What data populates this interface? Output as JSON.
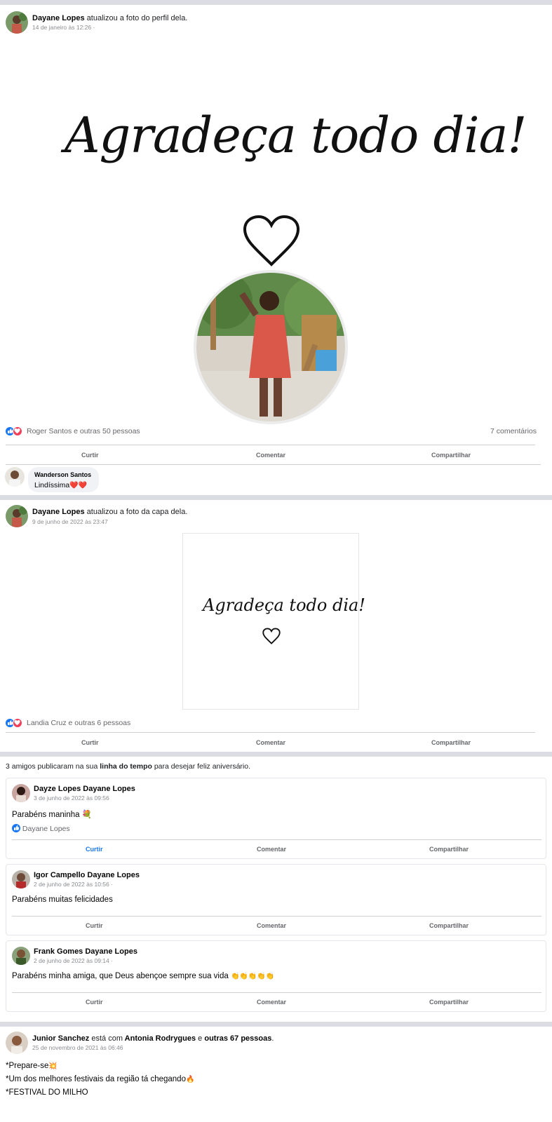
{
  "post1": {
    "author": "Dayane Lopes",
    "action": "atualizou a foto do perfil dela.",
    "date": "14 de janeiro às 12:26 ·",
    "script_text": "Agradeça todo dia!",
    "reactions": "Roger Santos e outras 50 pessoas",
    "comments_count": "7 comentários",
    "actions": {
      "like": "Curtir",
      "comment": "Comentar",
      "share": "Compartilhar"
    },
    "comment": {
      "author": "Wanderson Santos",
      "text": "Lindíssima",
      "emoji": "❤️❤️"
    }
  },
  "post2": {
    "author": "Dayane Lopes",
    "action": "atualizou a foto da capa dela.",
    "date": "9 de junho de 2022 às 23:47",
    "script_text": "Agradeça todo dia!",
    "reactions": "Landia Cruz e outras 6 pessoas",
    "actions": {
      "like": "Curtir",
      "comment": "Comentar",
      "share": "Compartilhar"
    }
  },
  "birthday": {
    "intro_pre": "3 amigos publicaram na sua",
    "intro_bold": "linha do tempo",
    "intro_post": "para desejar feliz aniversário.",
    "cards": [
      {
        "author": "Dayze Lopes Dayane Lopes",
        "date": "3 de junho de 2022 às 09:56",
        "text": "Parabéns maninha",
        "emoji": "💐",
        "liked_by": "Dayane Lopes",
        "actions": {
          "like": "Curtir",
          "comment": "Comentar",
          "share": "Compartilhar"
        }
      },
      {
        "author": "Igor Campello Dayane Lopes",
        "date": "2 de junho de 2022 às 10:56 ·",
        "text": "Parabéns muitas felicidades",
        "actions": {
          "like": "Curtir",
          "comment": "Comentar",
          "share": "Compartilhar"
        }
      },
      {
        "author": "Frank Gomes Dayane Lopes",
        "date": "2 de junho de 2022 às 09:14 ·",
        "text": "Parabéns minha amiga, que Deus abençoe sempre sua vida",
        "emoji": "👏👏👏👏👏",
        "actions": {
          "like": "Curtir",
          "comment": "Comentar",
          "share": "Compartilhar"
        }
      }
    ]
  },
  "post3": {
    "author": "Junior Sanchez",
    "with_word": "está com",
    "tagged": "Antonia Rodrygues",
    "and_word": "e",
    "others": "outras 67 pessoas",
    "period": ".",
    "date": "25 de novembro de 2021 às 06:46",
    "lines": [
      "*Prepare-se",
      "*Um dos melhores festivais da região tá chegando",
      "*FESTIVAL DO MILHO"
    ],
    "line_emojis": [
      "💥",
      "🔥",
      ""
    ]
  },
  "colors": {
    "like_blue": "#1877f2",
    "love_red": "#f33e58",
    "divider": "#dadde1"
  }
}
